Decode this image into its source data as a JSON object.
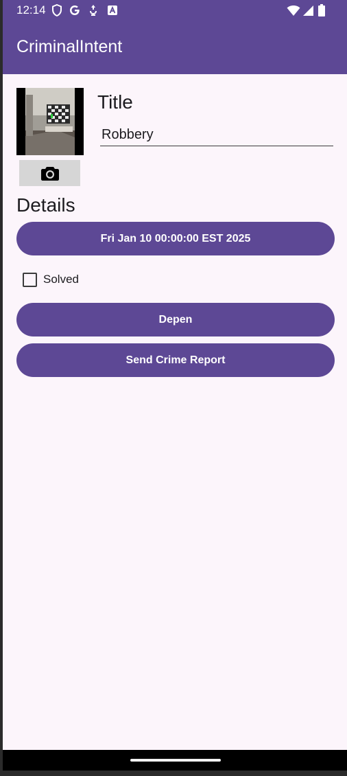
{
  "status_bar": {
    "time": "12:14",
    "left_icons": [
      "vpn-shield-icon",
      "google-icon",
      "data-saver-icon",
      "keyboard-icon"
    ],
    "right_icons": [
      "wifi-icon",
      "cell-signal-icon",
      "battery-icon"
    ]
  },
  "app_bar": {
    "title": "CriminalIntent",
    "color": "#5d4895"
  },
  "crime": {
    "title_label": "Title",
    "title_value": "Robbery",
    "details_label": "Details",
    "date_button": "Fri Jan 10 00:00:00 EST 2025",
    "solved_label": "Solved",
    "solved_checked": false,
    "suspect_button": "Depen",
    "report_button": "Send Crime Report"
  },
  "photo": {
    "icon": "crime-photo-thumbnail",
    "camera_icon": "camera-icon"
  },
  "colors": {
    "primary": "#5d4895",
    "background": "#fcf5fb",
    "camera_button": "#d6d6d6"
  }
}
